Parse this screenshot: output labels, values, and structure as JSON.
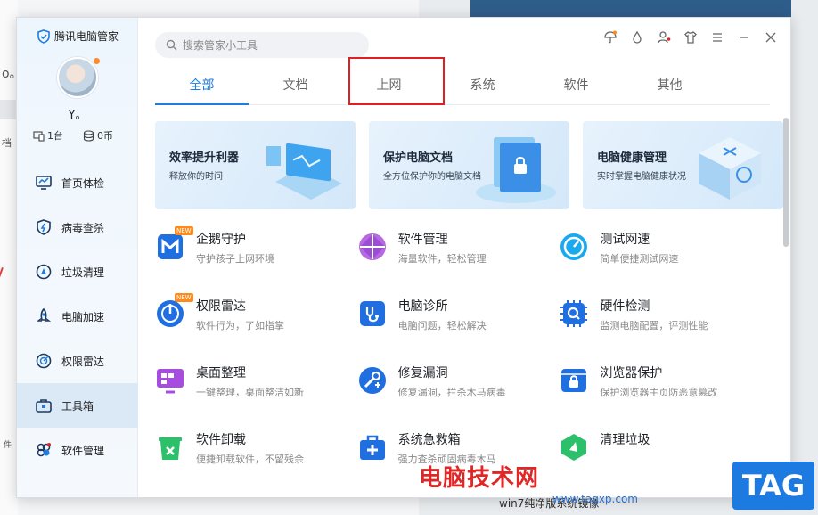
{
  "app": {
    "name": "腾讯电脑管家",
    "search_placeholder": "搜索管家小工具"
  },
  "user": {
    "name": "Y。",
    "devices": "1台",
    "coins": "0币"
  },
  "sidebar": {
    "items": [
      {
        "label": "首页体检",
        "icon": "monitor-icon"
      },
      {
        "label": "病毒查杀",
        "icon": "shield-bolt-icon"
      },
      {
        "label": "垃圾清理",
        "icon": "broom-icon"
      },
      {
        "label": "电脑加速",
        "icon": "rocket-icon"
      },
      {
        "label": "权限雷达",
        "icon": "radar-icon"
      },
      {
        "label": "工具箱",
        "icon": "toolbox-icon",
        "active": true
      },
      {
        "label": "软件管理",
        "icon": "apps-icon"
      }
    ]
  },
  "tabs": [
    {
      "label": "全部",
      "active": true
    },
    {
      "label": "文档"
    },
    {
      "label": "上网",
      "highlighted": true
    },
    {
      "label": "系统"
    },
    {
      "label": "软件"
    },
    {
      "label": "其他"
    }
  ],
  "banners": [
    {
      "title": "效率提升利器",
      "subtitle": "释放你的时间"
    },
    {
      "title": "保护电脑文档",
      "subtitle": "全方位保护你的电脑文档"
    },
    {
      "title": "电脑健康管理",
      "subtitle": "实时掌握电脑健康状况"
    }
  ],
  "tools": [
    {
      "title": "企鹅守护",
      "subtitle": "守护孩子上网环境",
      "new": "NEW",
      "icon": "penguin-guard-icon"
    },
    {
      "title": "软件管理",
      "subtitle": "海量软件，轻松管理",
      "icon": "software-manage-icon"
    },
    {
      "title": "测试网速",
      "subtitle": "简单便捷测试网速",
      "icon": "speed-test-icon"
    },
    {
      "title": "权限雷达",
      "subtitle": "软件行为，了如指掌",
      "new": "NEW",
      "icon": "radar-icon"
    },
    {
      "title": "电脑诊所",
      "subtitle": "电脑问题，轻松解决",
      "icon": "stethoscope-icon"
    },
    {
      "title": "硬件检测",
      "subtitle": "监测电脑配置，评测性能",
      "icon": "chip-icon"
    },
    {
      "title": "桌面整理",
      "subtitle": "一键整理，桌面整洁如新",
      "icon": "desktop-organize-icon"
    },
    {
      "title": "修复漏洞",
      "subtitle": "修复漏洞，拦杀木马病毒",
      "icon": "vulnerability-fix-icon"
    },
    {
      "title": "浏览器保护",
      "subtitle": "保护浏览器主页防恶意篡改",
      "icon": "browser-lock-icon"
    },
    {
      "title": "软件卸载",
      "subtitle": "便捷卸载软件，不留残余",
      "icon": "uninstall-icon"
    },
    {
      "title": "系统急救箱",
      "subtitle": "强力查杀顽固病毒木马",
      "icon": "first-aid-icon"
    },
    {
      "title": "清理垃圾",
      "subtitle": "",
      "icon": "clean-icon"
    }
  ],
  "background": {
    "left_text_1": "o。",
    "left_text_2": "档",
    "left_text_3": "件",
    "bottom_text": "win7纯净版系统镜像"
  },
  "watermark": {
    "text": "电脑技术网",
    "url": "www.tagxp.com",
    "logo": "TAG"
  },
  "colors": {
    "accent": "#1f7de0",
    "highlight_box": "#e02020",
    "new_badge": "#ff8a1c"
  }
}
